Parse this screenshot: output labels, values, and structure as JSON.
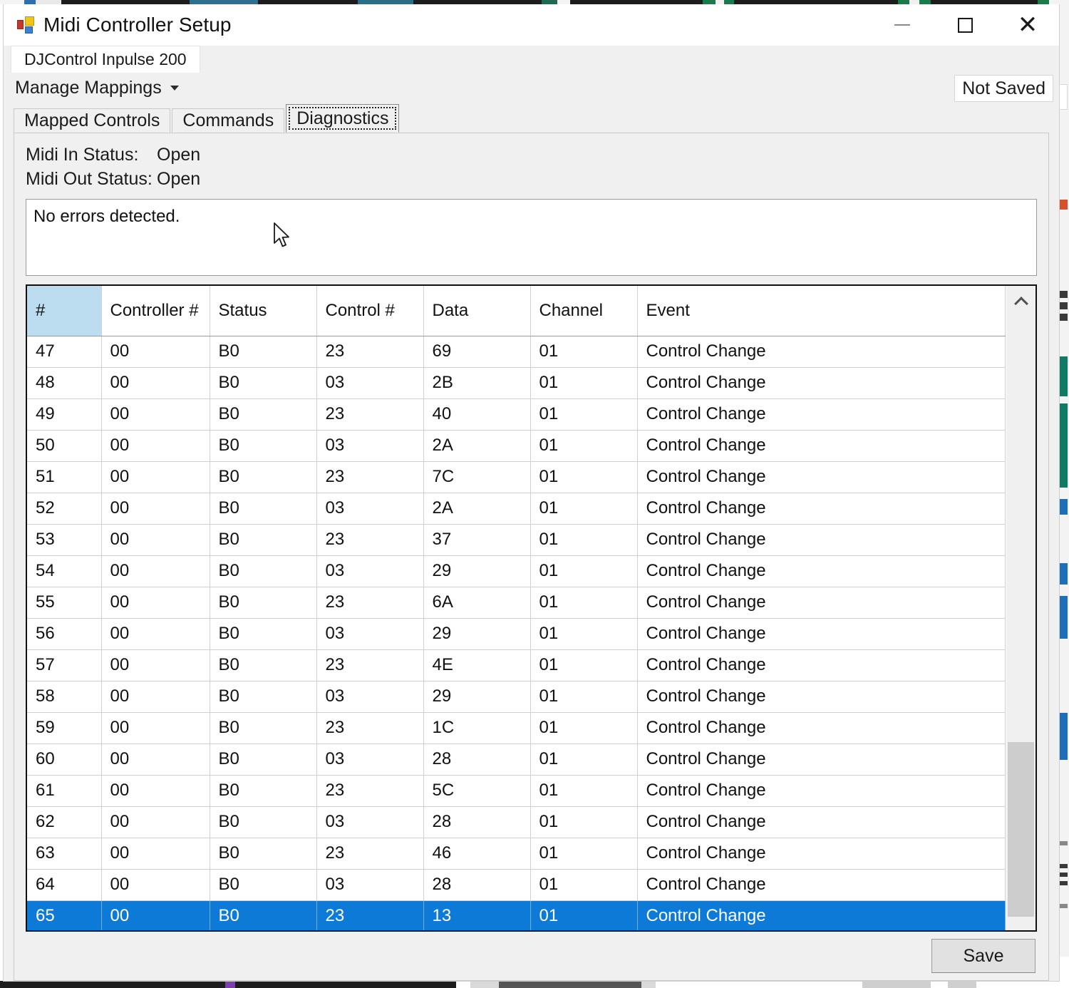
{
  "window": {
    "title": "Midi Controller Setup",
    "icon": "app-icon",
    "controls": {
      "minimize": "–",
      "maximize": "□",
      "close": "✕"
    }
  },
  "device_tabs": [
    {
      "label": "DJControl Inpulse 200",
      "active": true
    }
  ],
  "menubar": {
    "manage_mappings_label": "Manage Mappings",
    "save_state_label": "Not Saved"
  },
  "subtabs": [
    {
      "label": "Mapped Controls",
      "active": false
    },
    {
      "label": "Commands",
      "active": false
    },
    {
      "label": "Diagnostics",
      "active": true
    }
  ],
  "diagnostics": {
    "midi_in_label": "Midi In Status:",
    "midi_in_value": "Open",
    "midi_out_label": "Midi Out Status:",
    "midi_out_value": "Open",
    "error_text": "No errors detected."
  },
  "grid": {
    "columns": [
      "#",
      "Controller #",
      "Status",
      "Control #",
      "Data",
      "Channel",
      "Event"
    ],
    "rows": [
      {
        "num": "47",
        "controller": "00",
        "status": "B0",
        "control": "23",
        "data": "69",
        "channel": "01",
        "event": "Control Change",
        "selected": false
      },
      {
        "num": "48",
        "controller": "00",
        "status": "B0",
        "control": "03",
        "data": "2B",
        "channel": "01",
        "event": "Control Change",
        "selected": false
      },
      {
        "num": "49",
        "controller": "00",
        "status": "B0",
        "control": "23",
        "data": "40",
        "channel": "01",
        "event": "Control Change",
        "selected": false
      },
      {
        "num": "50",
        "controller": "00",
        "status": "B0",
        "control": "03",
        "data": "2A",
        "channel": "01",
        "event": "Control Change",
        "selected": false
      },
      {
        "num": "51",
        "controller": "00",
        "status": "B0",
        "control": "23",
        "data": "7C",
        "channel": "01",
        "event": "Control Change",
        "selected": false
      },
      {
        "num": "52",
        "controller": "00",
        "status": "B0",
        "control": "03",
        "data": "2A",
        "channel": "01",
        "event": "Control Change",
        "selected": false
      },
      {
        "num": "53",
        "controller": "00",
        "status": "B0",
        "control": "23",
        "data": "37",
        "channel": "01",
        "event": "Control Change",
        "selected": false
      },
      {
        "num": "54",
        "controller": "00",
        "status": "B0",
        "control": "03",
        "data": "29",
        "channel": "01",
        "event": "Control Change",
        "selected": false
      },
      {
        "num": "55",
        "controller": "00",
        "status": "B0",
        "control": "23",
        "data": "6A",
        "channel": "01",
        "event": "Control Change",
        "selected": false
      },
      {
        "num": "56",
        "controller": "00",
        "status": "B0",
        "control": "03",
        "data": "29",
        "channel": "01",
        "event": "Control Change",
        "selected": false
      },
      {
        "num": "57",
        "controller": "00",
        "status": "B0",
        "control": "23",
        "data": "4E",
        "channel": "01",
        "event": "Control Change",
        "selected": false
      },
      {
        "num": "58",
        "controller": "00",
        "status": "B0",
        "control": "03",
        "data": "29",
        "channel": "01",
        "event": "Control Change",
        "selected": false
      },
      {
        "num": "59",
        "controller": "00",
        "status": "B0",
        "control": "23",
        "data": "1C",
        "channel": "01",
        "event": "Control Change",
        "selected": false
      },
      {
        "num": "60",
        "controller": "00",
        "status": "B0",
        "control": "03",
        "data": "28",
        "channel": "01",
        "event": "Control Change",
        "selected": false
      },
      {
        "num": "61",
        "controller": "00",
        "status": "B0",
        "control": "23",
        "data": "5C",
        "channel": "01",
        "event": "Control Change",
        "selected": false
      },
      {
        "num": "62",
        "controller": "00",
        "status": "B0",
        "control": "03",
        "data": "28",
        "channel": "01",
        "event": "Control Change",
        "selected": false
      },
      {
        "num": "63",
        "controller": "00",
        "status": "B0",
        "control": "23",
        "data": "46",
        "channel": "01",
        "event": "Control Change",
        "selected": false
      },
      {
        "num": "64",
        "controller": "00",
        "status": "B0",
        "control": "03",
        "data": "28",
        "channel": "01",
        "event": "Control Change",
        "selected": false
      },
      {
        "num": "65",
        "controller": "00",
        "status": "B0",
        "control": "23",
        "data": "13",
        "channel": "01",
        "event": "Control Change",
        "selected": true
      }
    ]
  },
  "footer": {
    "save_label": "Save"
  },
  "colors": {
    "selection_blue": "#0d7ad8",
    "rowheader_blue": "#bcdcf0",
    "window_chrome": "#f0f0f0",
    "grid_border": "#111111"
  }
}
